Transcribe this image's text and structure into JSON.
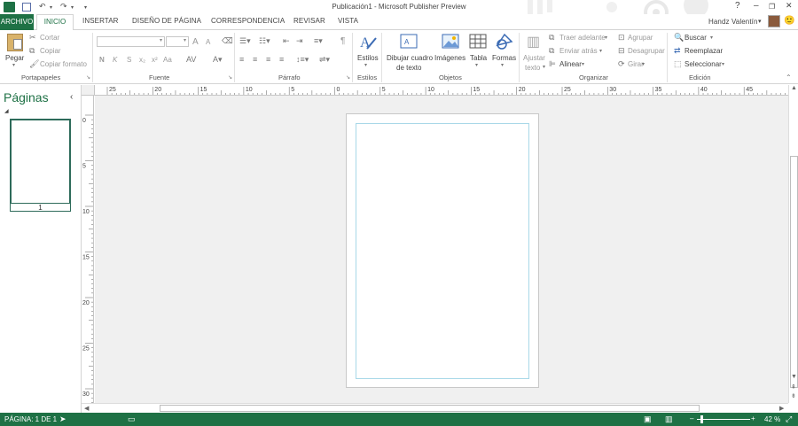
{
  "titlebar": {
    "title": "Publicación1 - Microsoft Publisher Preview",
    "help": "?",
    "minimize": "–",
    "restore": "❐",
    "close": "✕"
  },
  "tabs": {
    "file": "ARCHIVO",
    "home": "INICIO",
    "insert": "INSERTAR",
    "page_design": "DISEÑO DE PÁGINA",
    "mailings": "CORRESPONDENCIA",
    "review": "REVISAR",
    "view": "VISTA"
  },
  "user": {
    "name": "Handz Valentín",
    "caret": "▾",
    "smiley": "🙂"
  },
  "ribbon": {
    "clipboard": {
      "paste": "Pegar",
      "cut": "Cortar",
      "copy": "Copiar",
      "format_painter": "Copiar formato",
      "label": "Portapapeles"
    },
    "font": {
      "label": "Fuente",
      "bold": "N",
      "italic": "K",
      "strike": "S",
      "sub": "x₂",
      "sup": "x²",
      "case": "Aa",
      "grow": "A",
      "shrink": "A"
    },
    "paragraph": {
      "label": "Párrafo",
      "pilcrow": "¶"
    },
    "styles": {
      "button": "Estilos",
      "label": "Estilos"
    },
    "objects": {
      "draw_textbox_1": "Dibujar cuadro",
      "draw_textbox_2": "de texto",
      "pictures": "Imágenes",
      "table": "Tabla",
      "shapes": "Formas",
      "label": "Objetos"
    },
    "arrange": {
      "wrap_1": "Ajustar",
      "wrap_2": "texto",
      "bring_forward": "Traer adelante",
      "send_backward": "Enviar atrás",
      "align": "Alinear",
      "group": "Agrupar",
      "ungroup": "Desagrupar",
      "rotate": "Girar",
      "label": "Organizar"
    },
    "editing": {
      "find": "Buscar",
      "replace": "Reemplazar",
      "select": "Seleccionar",
      "label": "Edición"
    }
  },
  "pages_pane": {
    "title": "Páginas",
    "thumb_number": "1"
  },
  "ruler": {
    "h_labels": [
      "25",
      "20",
      "15",
      "10",
      "5",
      "0",
      "5",
      "10",
      "15",
      "20",
      "25",
      "30",
      "35",
      "40",
      "45"
    ],
    "v_labels": [
      "0",
      "5",
      "10",
      "15",
      "20",
      "25",
      "30"
    ]
  },
  "statusbar": {
    "page_info": "PÁGINA: 1 DE 1",
    "zoom": "42 %",
    "minus": "–",
    "plus": "+"
  },
  "colors": {
    "accent": "#1e7145",
    "margin_guide": "#a8d8e8"
  }
}
